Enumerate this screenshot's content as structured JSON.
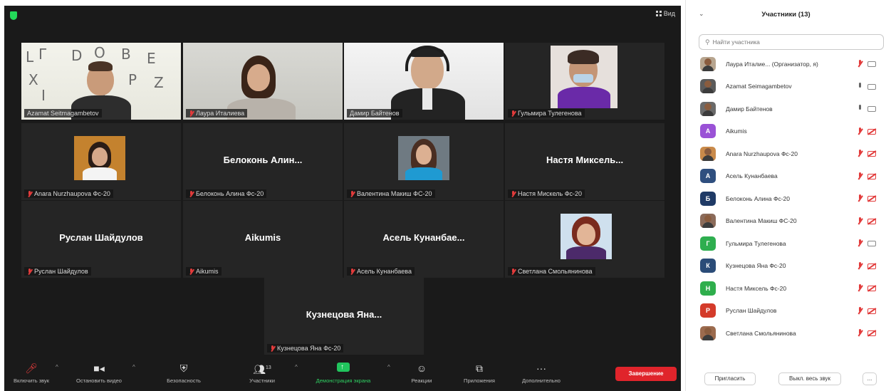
{
  "meeting": {
    "view_label": "Вид",
    "accent_speaker": "#c9e64b",
    "tiles": [
      {
        "name": "Azamat Seitmagambetov",
        "display": "video",
        "muted": false
      },
      {
        "name": "Лаура Италиева",
        "display": "video",
        "muted": true
      },
      {
        "name": "Дамир Байтенов",
        "display": "video",
        "muted": false
      },
      {
        "name": "Гульмира Тулегенова",
        "display": "photo",
        "muted": true
      },
      {
        "name": "Anara Nurzhaupova Фс-20",
        "display": "photo",
        "muted": true
      },
      {
        "name": "Белоконь Алина Фс-20",
        "big": "Белоконь Алин...",
        "display": "name",
        "muted": true
      },
      {
        "name": "Валентина Макиш ФС-20",
        "display": "photo",
        "muted": true
      },
      {
        "name": "Настя Мискель Фс-20",
        "big": "Настя Миксель...",
        "display": "name",
        "muted": true
      },
      {
        "name": "Руслан Шайдулов",
        "big": "Руслан Шайдулов",
        "display": "name",
        "muted": true
      },
      {
        "name": "Aikumis",
        "big": "Aikumis",
        "display": "name",
        "muted": true
      },
      {
        "name": "Асель Кунанбаева",
        "big": "Асель Кунанбае...",
        "display": "name",
        "muted": true
      },
      {
        "name": "Светлана Смольянинова",
        "display": "photo",
        "muted": true
      },
      {
        "name": "Кузнецова Яна Фс-20",
        "big": "Кузнецова Яна...",
        "display": "name",
        "muted": true
      }
    ]
  },
  "toolbar": {
    "mute": "Включить звук",
    "video": "Остановить видео",
    "security": "Безопасность",
    "participants": "Участники",
    "participants_count": "13",
    "share": "Демонстрация экрана",
    "reactions": "Реакции",
    "apps": "Приложения",
    "more": "Дополнительно",
    "end": "Завершение"
  },
  "panel": {
    "title": "Участники (13)",
    "search_placeholder": "Найти участника",
    "participants": [
      {
        "name": "Лаура Италие...  (Организатор, я)",
        "avatar": "photo",
        "letter": "",
        "color": "#b7a58f",
        "mic": "muted",
        "cam": "on"
      },
      {
        "name": "Azamat Seimagambetov",
        "avatar": "photo",
        "letter": "",
        "color": "#5b5b5b",
        "mic": "on",
        "cam": "on"
      },
      {
        "name": "Дамир Байтенов",
        "avatar": "photo",
        "letter": "",
        "color": "#6a6a6a",
        "mic": "on",
        "cam": "on"
      },
      {
        "name": "Aikumis",
        "avatar": "letter",
        "letter": "A",
        "color": "#9a52d6",
        "mic": "muted",
        "cam": "off"
      },
      {
        "name": "Anara Nurzhaupova Фс-20",
        "avatar": "photo",
        "letter": "",
        "color": "#c98a4a",
        "mic": "muted",
        "cam": "off"
      },
      {
        "name": "Асель Кунанбаева",
        "avatar": "letter",
        "letter": "А",
        "color": "#2f4f7f",
        "mic": "muted",
        "cam": "off"
      },
      {
        "name": "Белоконь Алина Фс-20",
        "avatar": "letter",
        "letter": "Б",
        "color": "#1f3a66",
        "mic": "muted",
        "cam": "off"
      },
      {
        "name": "Валентина Макиш ФС-20",
        "avatar": "photo",
        "letter": "",
        "color": "#8b6b5a",
        "mic": "muted",
        "cam": "off"
      },
      {
        "name": "Гульмира Тулегенова",
        "avatar": "letter",
        "letter": "Г",
        "color": "#2eae4f",
        "mic": "muted",
        "cam": "on"
      },
      {
        "name": "Кузнецова Яна Фс-20",
        "avatar": "letter",
        "letter": "К",
        "color": "#2b4c78",
        "mic": "muted",
        "cam": "off"
      },
      {
        "name": "Настя Миксель Фс-20",
        "avatar": "letter",
        "letter": "Н",
        "color": "#2fae4c",
        "mic": "muted",
        "cam": "off"
      },
      {
        "name": "Руслан Шайдулов",
        "avatar": "letter",
        "letter": "Р",
        "color": "#d43b2a",
        "mic": "muted",
        "cam": "off"
      },
      {
        "name": "Светлана Смольянинова",
        "avatar": "photo",
        "letter": "",
        "color": "#9c6b4e",
        "mic": "muted",
        "cam": "off"
      }
    ],
    "invite": "Пригласить",
    "mute_all": "Выкл. весь звук",
    "more": "..."
  }
}
